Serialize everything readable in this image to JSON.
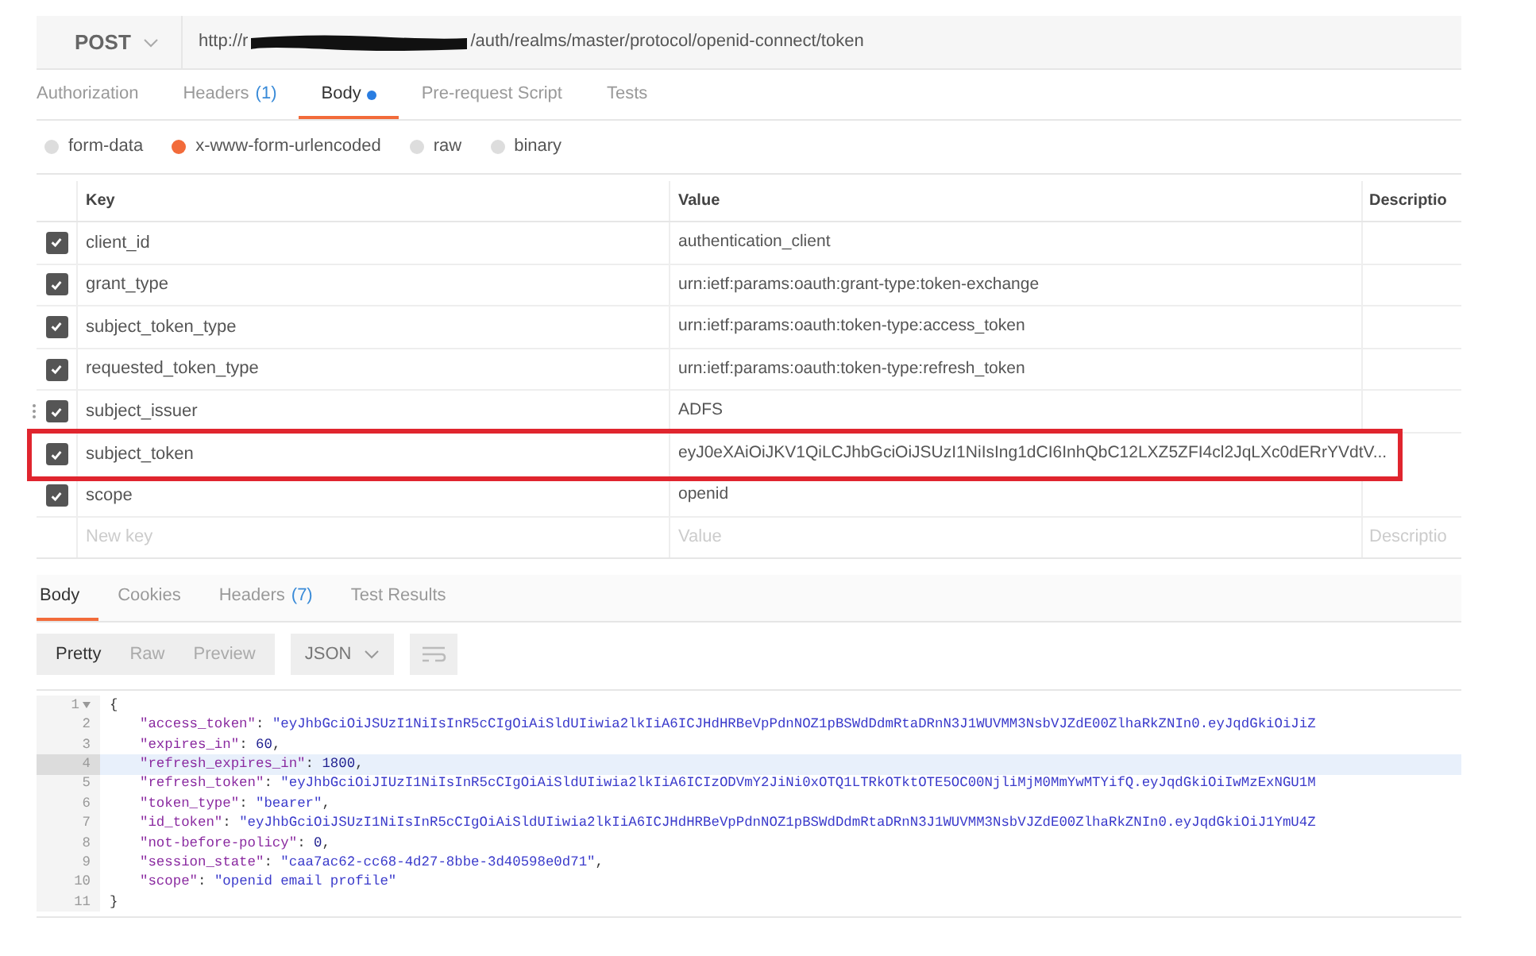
{
  "request": {
    "method": "POST",
    "url_start": "http://r",
    "url_end": "/auth/realms/master/protocol/openid-connect/token"
  },
  "request_tabs": [
    {
      "label": "Authorization",
      "modified": false,
      "selected": false
    },
    {
      "label": "Headers",
      "count": "(1)",
      "modified": false,
      "selected": false
    },
    {
      "label": "Body",
      "modified": true,
      "selected": true
    },
    {
      "label": "Pre-request Script",
      "modified": false,
      "selected": false
    },
    {
      "label": "Tests",
      "modified": false,
      "selected": false
    }
  ],
  "body_types": [
    {
      "label": "form-data",
      "selected": false
    },
    {
      "label": "x-www-form-urlencoded",
      "selected": true
    },
    {
      "label": "raw",
      "selected": false
    },
    {
      "label": "binary",
      "selected": false
    }
  ],
  "params_table": {
    "columns": [
      "Key",
      "Value",
      "Descriptio"
    ],
    "rows": [
      {
        "key": "client_id",
        "value": "authentication_client",
        "checked": true,
        "drag_handle": false,
        "highlighted": false
      },
      {
        "key": "grant_type",
        "value": "urn:ietf:params:oauth:grant-type:token-exchange",
        "checked": true,
        "drag_handle": false,
        "highlighted": false
      },
      {
        "key": "subject_token_type",
        "value": "urn:ietf:params:oauth:token-type:access_token",
        "checked": true,
        "drag_handle": false,
        "highlighted": false
      },
      {
        "key": "requested_token_type",
        "value": "urn:ietf:params:oauth:token-type:refresh_token",
        "checked": true,
        "drag_handle": false,
        "highlighted": false
      },
      {
        "key": "subject_issuer",
        "value": "ADFS",
        "checked": true,
        "drag_handle": true,
        "highlighted": false
      },
      {
        "key": "subject_token",
        "value": "eyJ0eXAiOiJKV1QiLCJhbGciOiJSUzI1NiIsIng1dCI6InhQbC12LXZ5ZFI4cl2JqLXc0dERrYVdtV...",
        "checked": true,
        "drag_handle": false,
        "highlighted": true
      },
      {
        "key": "scope",
        "value": "openid",
        "checked": true,
        "drag_handle": false,
        "highlighted": false
      }
    ],
    "new_row": {
      "key_placeholder": "New key",
      "value_placeholder": "Value",
      "description_placeholder": "Descriptio"
    }
  },
  "response_tabs": [
    {
      "label": "Body",
      "selected": true
    },
    {
      "label": "Cookies",
      "selected": false
    },
    {
      "label": "Headers",
      "count": "(7)",
      "selected": false
    },
    {
      "label": "Test Results",
      "selected": false
    }
  ],
  "view_modes": [
    {
      "label": "Pretty",
      "selected": true
    },
    {
      "label": "Raw",
      "selected": false
    },
    {
      "label": "Preview",
      "selected": false
    }
  ],
  "format": "JSON",
  "code_lines": [
    {
      "number": "1",
      "fold": true,
      "selected": false,
      "tokens": [
        {
          "kind": "punct",
          "text": "{"
        }
      ]
    },
    {
      "number": "2",
      "fold": false,
      "selected": false,
      "tokens": [
        {
          "kind": "key",
          "text": "\"access_token\""
        },
        {
          "kind": "punct",
          "text": ": "
        },
        {
          "kind": "string",
          "text": "\"eyJhbGciOiJSUzI1NiIsInR5cCIgOiAiSldUIiwia2lkIiA6ICJHdHRBeVpPdnNOZ1pBSWdDdmRtaDRnN3J1WUVMM3NsbVJZdE00ZlhaRkZNIn0.eyJqdGkiOiJiZ"
        }
      ]
    },
    {
      "number": "3",
      "fold": false,
      "selected": false,
      "tokens": [
        {
          "kind": "key",
          "text": "\"expires_in\""
        },
        {
          "kind": "punct",
          "text": ": "
        },
        {
          "kind": "number",
          "text": "60"
        },
        {
          "kind": "punct",
          "text": ","
        }
      ]
    },
    {
      "number": "4",
      "fold": false,
      "selected": true,
      "tokens": [
        {
          "kind": "key",
          "text": "\"refresh_expires_in\""
        },
        {
          "kind": "punct",
          "text": ": "
        },
        {
          "kind": "number",
          "text": "1800"
        },
        {
          "kind": "punct",
          "text": ","
        }
      ]
    },
    {
      "number": "5",
      "fold": false,
      "selected": false,
      "tokens": [
        {
          "kind": "key",
          "text": "\"refresh_token\""
        },
        {
          "kind": "punct",
          "text": ": "
        },
        {
          "kind": "string",
          "text": "\"eyJhbGciOiJIUzI1NiIsInR5cCIgOiAiSldUIiwia2lkIiA6ICIzODVmY2JiNi0xOTQ1LTRkOTktOTE5OC00NjliMjM0MmYwMTYifQ.eyJqdGkiOiIwMzExNGU1M"
        }
      ]
    },
    {
      "number": "6",
      "fold": false,
      "selected": false,
      "tokens": [
        {
          "kind": "key",
          "text": "\"token_type\""
        },
        {
          "kind": "punct",
          "text": ": "
        },
        {
          "kind": "string",
          "text": "\"bearer\""
        },
        {
          "kind": "punct",
          "text": ","
        }
      ]
    },
    {
      "number": "7",
      "fold": false,
      "selected": false,
      "tokens": [
        {
          "kind": "key",
          "text": "\"id_token\""
        },
        {
          "kind": "punct",
          "text": ": "
        },
        {
          "kind": "string",
          "text": "\"eyJhbGciOiJSUzI1NiIsInR5cCIgOiAiSldUIiwia2lkIiA6ICJHdHRBeVpPdnNOZ1pBSWdDdmRtaDRnN3J1WUVMM3NsbVJZdE00ZlhaRkZNIn0.eyJqdGkiOiJ1YmU4Z"
        }
      ]
    },
    {
      "number": "8",
      "fold": false,
      "selected": false,
      "tokens": [
        {
          "kind": "key",
          "text": "\"not-before-policy\""
        },
        {
          "kind": "punct",
          "text": ": "
        },
        {
          "kind": "number",
          "text": "0"
        },
        {
          "kind": "punct",
          "text": ","
        }
      ]
    },
    {
      "number": "9",
      "fold": false,
      "selected": false,
      "tokens": [
        {
          "kind": "key",
          "text": "\"session_state\""
        },
        {
          "kind": "punct",
          "text": ": "
        },
        {
          "kind": "string",
          "text": "\"caa7ac62-cc68-4d27-8bbe-3d40598e0d71\""
        },
        {
          "kind": "punct",
          "text": ","
        }
      ]
    },
    {
      "number": "10",
      "fold": false,
      "selected": false,
      "tokens": [
        {
          "kind": "key",
          "text": "\"scope\""
        },
        {
          "kind": "punct",
          "text": ": "
        },
        {
          "kind": "string",
          "text": "\"openid email profile\""
        }
      ]
    },
    {
      "number": "11",
      "fold": false,
      "selected": false,
      "tokens": [
        {
          "kind": "punct",
          "text": "}"
        }
      ]
    }
  ]
}
